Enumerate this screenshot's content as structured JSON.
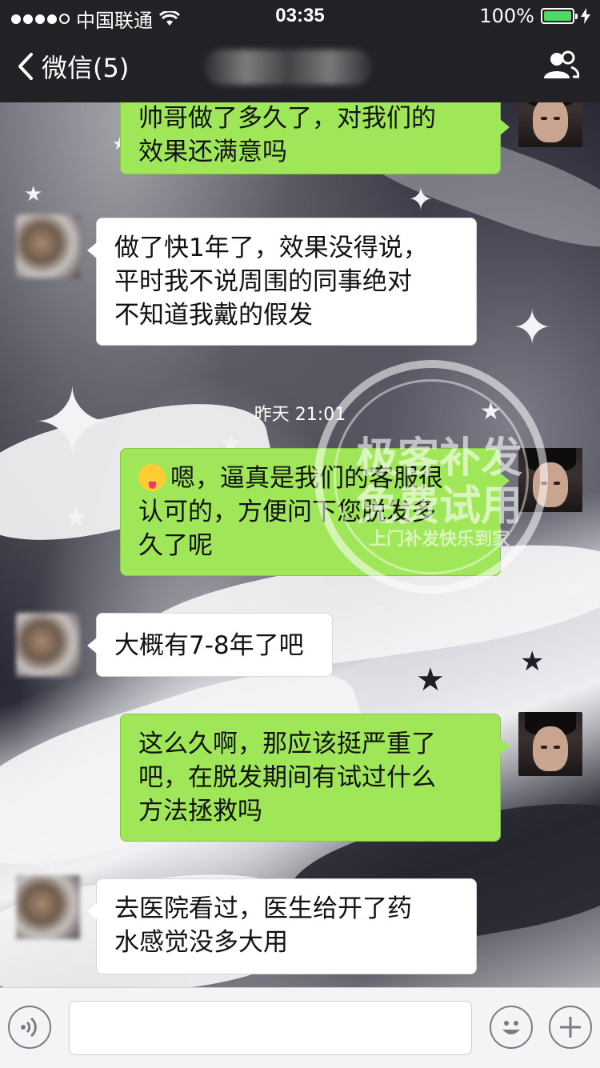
{
  "status_bar": {
    "carrier": "中国联通",
    "time": "03:35",
    "battery": "100%",
    "signal_icon": "signal-dots-icon",
    "wifi_icon": "wifi-icon",
    "battery_icon": "battery-icon",
    "charging_icon": "charging-bolt-icon"
  },
  "nav": {
    "back_label": "微信(5)",
    "back_icon": "chevron-left-icon",
    "contact_icon": "people-icon"
  },
  "messages": [
    {
      "side": "right",
      "lines": [
        "帅哥做了多久了，对我们的",
        "效果还满意吗"
      ]
    },
    {
      "side": "left",
      "lines": [
        "做了快1年了，效果没得说，",
        "平时我不说周围的同事绝对",
        "不知道我戴的假发"
      ]
    },
    {
      "timestamp": "昨天 21:01"
    },
    {
      "side": "right",
      "emoji": "winking-tongue-emoji",
      "lines": [
        "嗯，逼真是我们的客服很",
        "认可的，方便问下您脱发多",
        "久了呢"
      ]
    },
    {
      "side": "left",
      "lines": [
        "大概有7-8年了吧"
      ]
    },
    {
      "side": "right",
      "lines": [
        "这么久啊，那应该挺严重了",
        "吧，在脱发期间有试过什么",
        "方法拯救吗"
      ]
    },
    {
      "side": "left",
      "lines": [
        "去医院看过，医生给开了药",
        "水感觉没多大用"
      ]
    }
  ],
  "watermark": {
    "line1": "极客补发",
    "line2": "免费试用",
    "line3": "上门补发快乐到家"
  },
  "input_bar": {
    "voice_icon": "voice-icon",
    "emoji_icon": "emoji-face-icon",
    "plus_icon": "plus-icon",
    "input_value": ""
  },
  "colors": {
    "bar_bg": "#222226",
    "bubble_green": "#9fe658",
    "bubble_white": "#ffffff",
    "battery_green": "#4cd964"
  }
}
